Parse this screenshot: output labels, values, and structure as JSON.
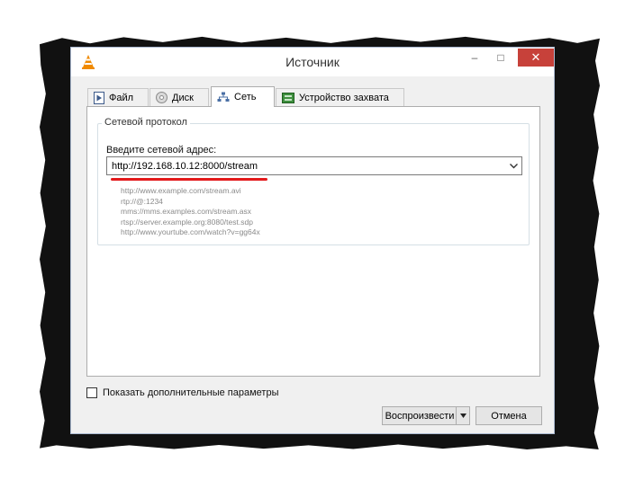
{
  "window": {
    "title": "Источник",
    "app_icon": "vlc-cone-icon",
    "controls": {
      "minimize": "–",
      "maximize": "□",
      "close": "✕"
    }
  },
  "tabs": [
    {
      "label": "Файл",
      "icon": "file-icon"
    },
    {
      "label": "Диск",
      "icon": "disc-icon"
    },
    {
      "label": "Сеть",
      "icon": "network-icon",
      "active": true
    },
    {
      "label": "Устройство захвата",
      "icon": "capture-device-icon"
    }
  ],
  "network": {
    "group_title": "Сетевой протокол",
    "address_label": "Введите сетевой адрес:",
    "address_value": "http://192.168.10.12:8000/stream",
    "examples": [
      "http://www.example.com/stream.avi",
      "rtp://@:1234",
      "mms://mms.examples.com/stream.asx",
      "rtsp://server.example.org:8080/test.sdp",
      "http://www.yourtube.com/watch?v=gg64x"
    ]
  },
  "options": {
    "advanced_label": "Показать дополнительные параметры",
    "advanced_checked": false
  },
  "buttons": {
    "play": "Воспроизвести",
    "cancel": "Отмена"
  },
  "colors": {
    "highlight_underline": "#e3191b",
    "close_button": "#c7413a",
    "frame": "#111111"
  }
}
